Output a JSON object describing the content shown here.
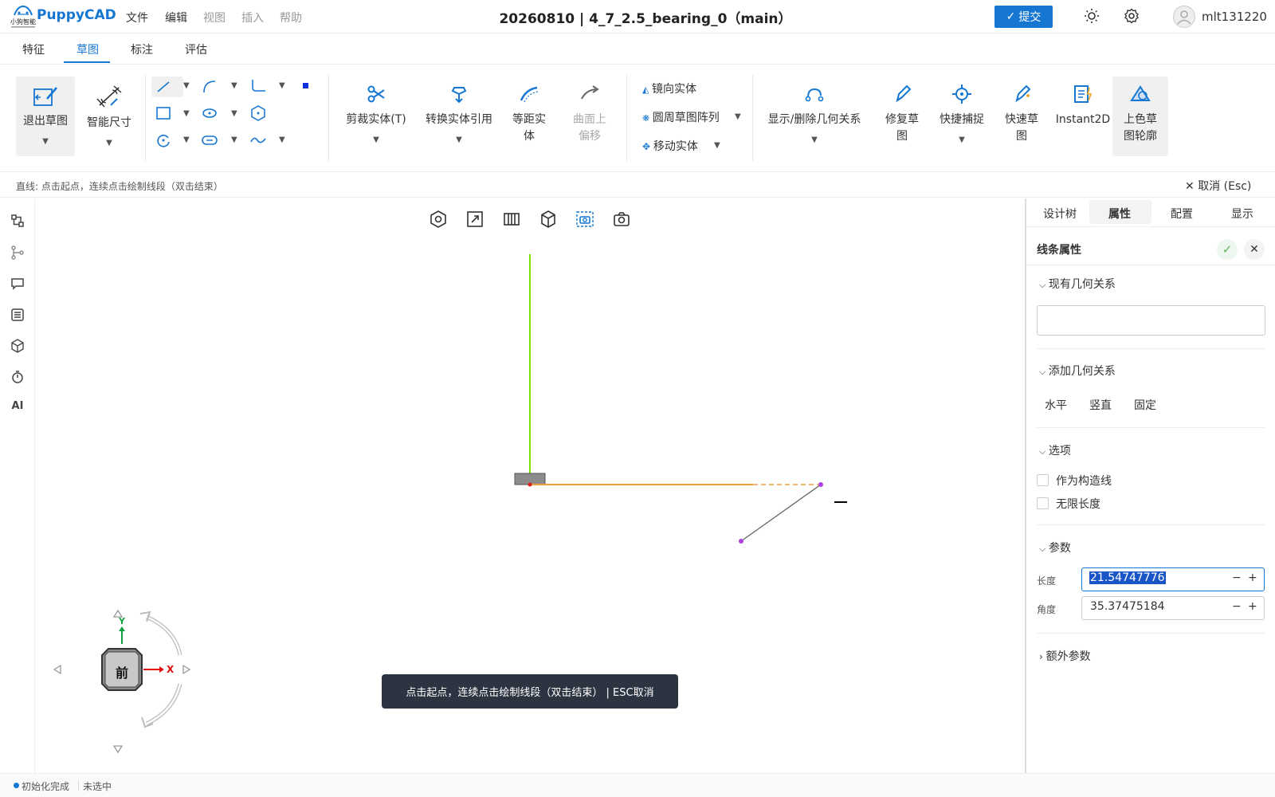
{
  "app": {
    "brand": "PuppyCAD",
    "logo_text": "小狗智能"
  },
  "menu": [
    "文件",
    "编辑",
    "视图",
    "插入",
    "帮助"
  ],
  "document_title": "20260810 | 4_7_2.5_bearing_0（main）",
  "submit_label": "提交",
  "username": "mlt131220",
  "tabs": [
    "特征",
    "草图",
    "标注",
    "评估"
  ],
  "active_tab": "草图",
  "ribbon": {
    "exit_sketch": "退出草图",
    "smart_dimension": "智能尺寸",
    "trim": "剪裁实体(T)",
    "convert": "转换实体引用",
    "offset": [
      "等距实",
      "体"
    ],
    "surface_offset": [
      "曲面上",
      "偏移"
    ],
    "mirror": "镜向实体",
    "circular_pattern": "圆周草图阵列",
    "move": "移动实体",
    "show_relations": "显示/删除几何关系",
    "repair": [
      "修复草",
      "图"
    ],
    "quick_snap": "快捷捕捉",
    "rapid_sketch": [
      "快速草",
      "图"
    ],
    "instant2d": "Instant2D",
    "shaded_contour": [
      "上色草",
      "图轮廓"
    ]
  },
  "hint": "直线: 点击起点，连续点击绘制线段（双击结束）",
  "cancel_esc": "取消 (Esc)",
  "toast": "点击起点，连续点击绘制线段（双击结束） | ESC取消",
  "view_cube": {
    "front": "前",
    "x_axis": "X",
    "y_axis": "Y"
  },
  "left_icons": [
    "design-tree-icon",
    "branch-icon",
    "comment-icon",
    "list-icon",
    "cube-icon",
    "timer-icon",
    "AI"
  ],
  "panel": {
    "tabs": [
      "设计树",
      "属性",
      "配置",
      "显示"
    ],
    "active_tab": "属性",
    "title": "线条属性",
    "existing_relations": "现有几何关系",
    "add_relations": "添加几何关系",
    "relations": [
      "水平",
      "竖直",
      "固定"
    ],
    "options": "选项",
    "construction": "作为构造线",
    "infinite": "无限长度",
    "params": "参数",
    "length_label": "长度",
    "length_value": "21.54747776",
    "angle_label": "角度",
    "angle_value": "35.37475184",
    "extra_params": "额外参数"
  },
  "status": {
    "init": "初始化完成",
    "selection": "未选中"
  },
  "colors": {
    "accent": "#1677d2",
    "y_axis_line": "#7be000",
    "sketch_line": "#f0a040",
    "point": "#b040e0"
  }
}
